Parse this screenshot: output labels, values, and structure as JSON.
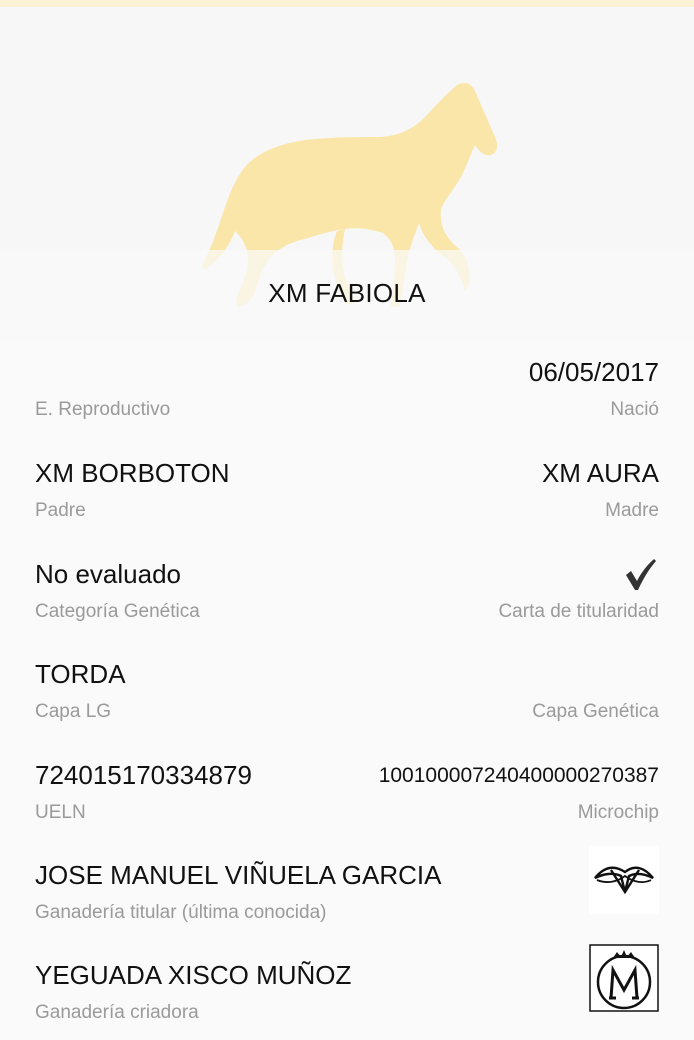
{
  "horse": {
    "name": "XM FABIOLA"
  },
  "fields": {
    "reproductivo": {
      "value": "",
      "label": "E. Reproductivo"
    },
    "nacio": {
      "value": "06/05/2017",
      "label": "Nació"
    },
    "padre": {
      "value": "XM BORBOTON",
      "label": "Padre"
    },
    "madre": {
      "value": "XM AURA",
      "label": "Madre"
    },
    "categoria": {
      "value": "No evaluado",
      "label": "Categoría Genética"
    },
    "carta": {
      "icon": "checkmark-icon",
      "label": "Carta de titularidad"
    },
    "capa_lg": {
      "value": "TORDA",
      "label": "Capa LG"
    },
    "capa_genetica": {
      "value": "",
      "label": "Capa Genética"
    },
    "ueln": {
      "value": "724015170334879",
      "label": "UELN"
    },
    "microchip": {
      "value": "100100007240400000270387",
      "label": "Microchip"
    },
    "ganaderia_titular": {
      "value": "JOSE MANUEL VIÑUELA GARCIA",
      "label": "Ganadería titular (última conocida)",
      "logo": "breeder-brand-logo"
    },
    "ganaderia_criadora": {
      "value": "YEGUADA XISCO MUÑOZ",
      "label": "Ganadería criadora",
      "logo": "crowned-m-logo"
    }
  },
  "colors": {
    "horse_silhouette": "#f9e6a8",
    "label": "#9a9a9a",
    "value": "#111111",
    "background": "#fafafa"
  }
}
